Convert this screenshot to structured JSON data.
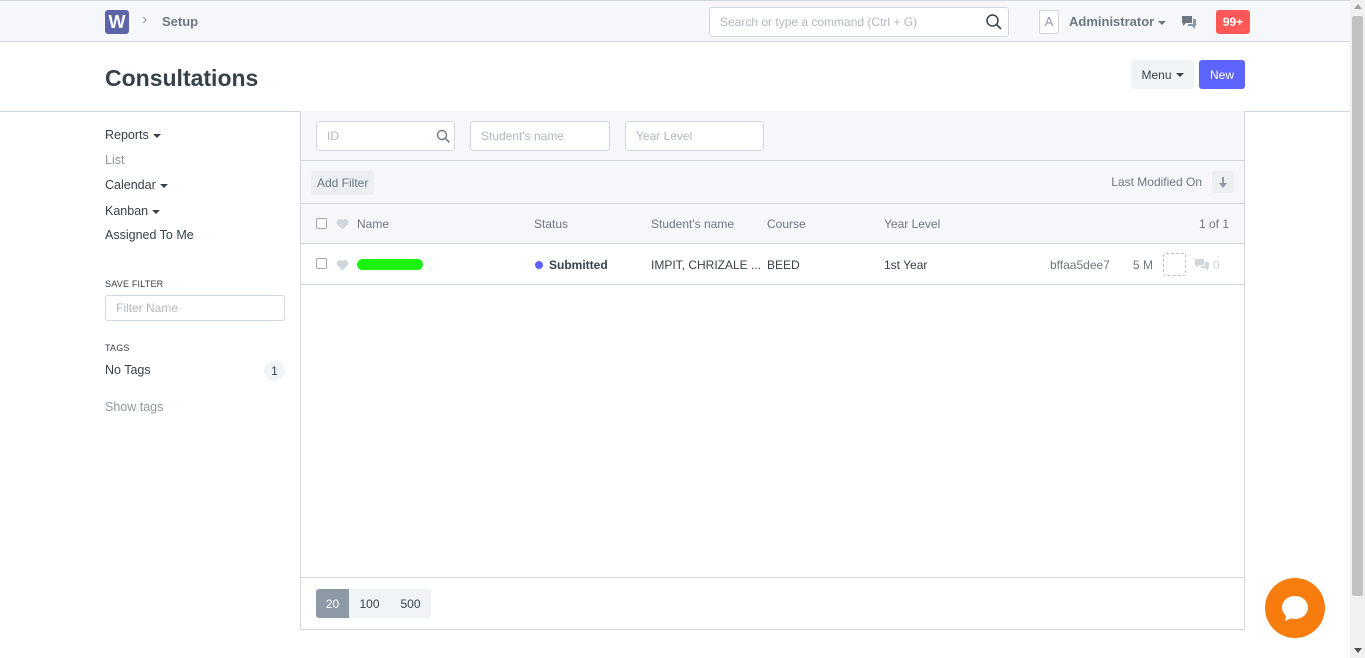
{
  "navbar": {
    "logo_letter": "W",
    "breadcrumb": "Setup",
    "search_placeholder": "Search or type a command (Ctrl + G)",
    "avatar_letter": "A",
    "user": "Administrator",
    "notifications": "99+"
  },
  "page": {
    "title": "Consultations",
    "menu_label": "Menu",
    "new_label": "New"
  },
  "sidebar": {
    "items": [
      "Reports",
      "List",
      "Calendar",
      "Kanban",
      "Assigned To Me"
    ],
    "save_filter_label": "SAVE FILTER",
    "filter_name_placeholder": "Filter Name",
    "tags_label": "TAGS",
    "no_tags": "No Tags",
    "no_tags_count": "1",
    "show_tags": "Show tags"
  },
  "filters": {
    "id_placeholder": "ID",
    "student_placeholder": "Student's name",
    "year_placeholder": "Year Level",
    "add_filter": "Add Filter",
    "sort_label": "Last Modified On"
  },
  "list": {
    "columns": {
      "name": "Name",
      "status": "Status",
      "student": "Student's name",
      "course": "Course",
      "year": "Year Level"
    },
    "count": "1 of 1",
    "rows": [
      {
        "status": "Submitted",
        "student": "IMPIT, CHRIZALE ...",
        "course": "BEED",
        "year": "1st Year",
        "id": "bffaa5dee7",
        "modified": "5 M",
        "comments": "0"
      }
    ]
  },
  "paging": {
    "sizes": [
      "20",
      "100",
      "500"
    ],
    "active": "20"
  },
  "colors": {
    "primary": "#5e64ff",
    "notification": "#ff5858",
    "chat": "#f87d0e",
    "logo": "#5e64a8"
  }
}
